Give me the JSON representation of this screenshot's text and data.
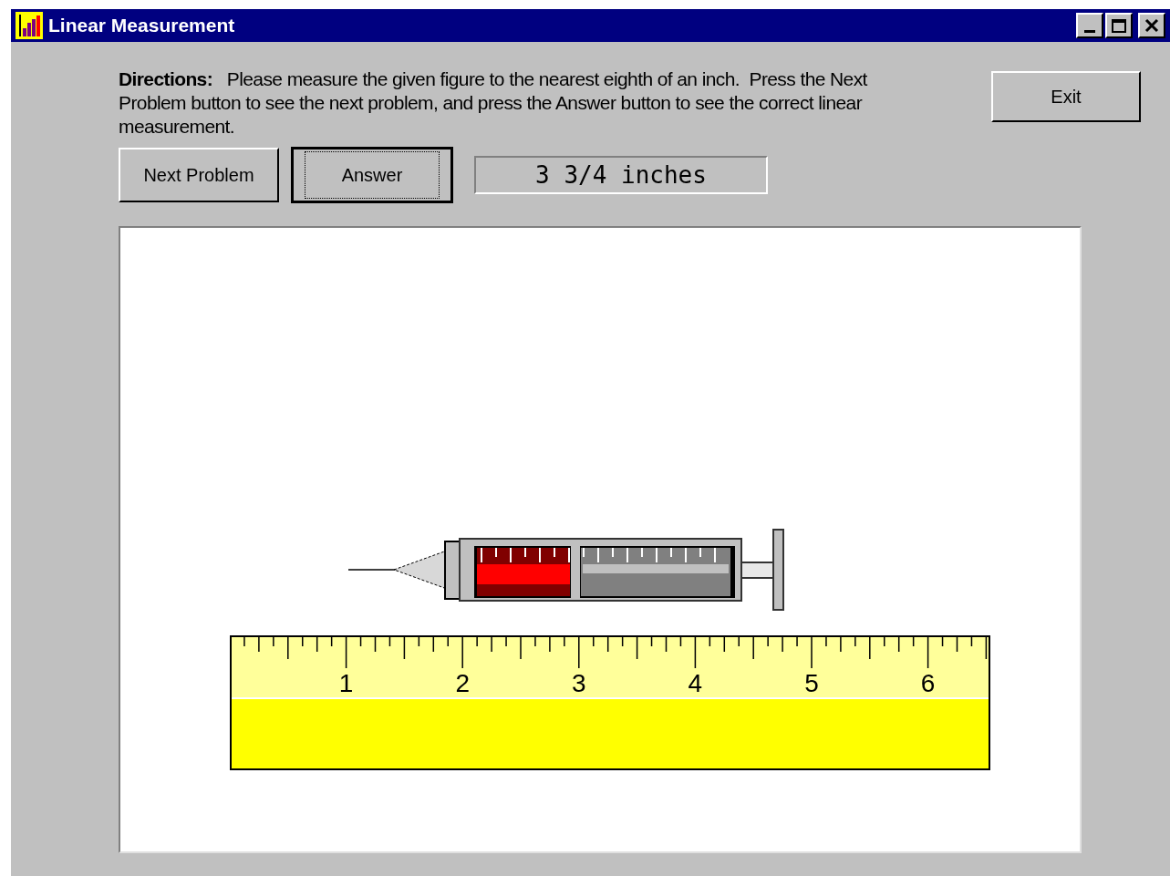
{
  "window": {
    "title": "Linear Measurement"
  },
  "directions": "**Directions:**   Please measure the given figure to the nearest eighth of an inch.  Press the Next Problem button to see the next problem, and press the Answer button to see the correct linear measurement.",
  "exit_button": "Exit",
  "buttons": [
    {
      "label": "Next Problem",
      "focused": false
    },
    {
      "label": "Answer",
      "focused": true
    }
  ],
  "answer_display": "3 3/4 inches",
  "ruler": {
    "labels": [
      "1",
      "2",
      "3",
      "4",
      "5",
      "6"
    ]
  }
}
